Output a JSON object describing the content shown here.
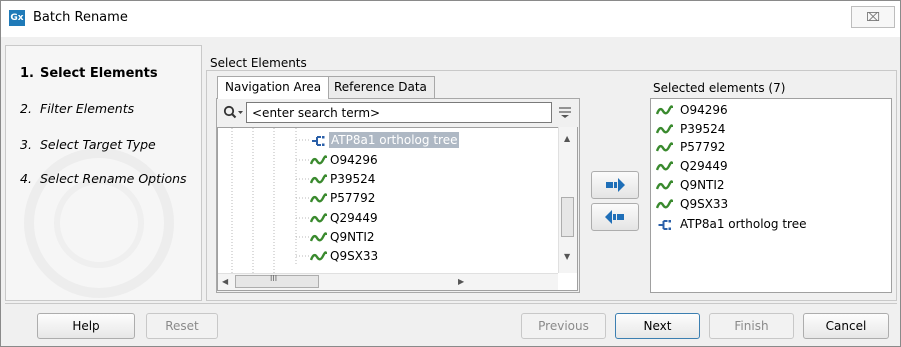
{
  "window": {
    "title": "Batch Rename",
    "app_icon_text": "Gx",
    "close_symbol": "⌧"
  },
  "steps": [
    {
      "num": "1.",
      "label": "Select Elements",
      "active": true
    },
    {
      "num": "2.",
      "label": "Filter Elements",
      "active": false
    },
    {
      "num": "3.",
      "label": "Select Target Type",
      "active": false
    },
    {
      "num": "4.",
      "label": "Select Rename Options",
      "active": false
    }
  ],
  "main": {
    "section_label": "Select Elements",
    "tabs": [
      {
        "label": "Navigation Area",
        "active": true
      },
      {
        "label": "Reference Data",
        "active": false
      }
    ],
    "search": {
      "placeholder": "<enter search term>",
      "value": ""
    },
    "tree": [
      {
        "label": "ATP8a1 ortholog tree",
        "icon": "tree-icon",
        "selected": true
      },
      {
        "label": "O94296",
        "icon": "sequence-icon",
        "selected": false
      },
      {
        "label": "P39524",
        "icon": "sequence-icon",
        "selected": false
      },
      {
        "label": "P57792",
        "icon": "sequence-icon",
        "selected": false
      },
      {
        "label": "Q29449",
        "icon": "sequence-icon",
        "selected": false
      },
      {
        "label": "Q9NTI2",
        "icon": "sequence-icon",
        "selected": false
      },
      {
        "label": "Q9SX33",
        "icon": "sequence-icon",
        "selected": false
      }
    ],
    "hscroll_glyph": "III"
  },
  "selected": {
    "label": "Selected elements (7)",
    "items": [
      {
        "label": "O94296",
        "icon": "sequence-icon"
      },
      {
        "label": "P39524",
        "icon": "sequence-icon"
      },
      {
        "label": "P57792",
        "icon": "sequence-icon"
      },
      {
        "label": "Q29449",
        "icon": "sequence-icon"
      },
      {
        "label": "Q9NTI2",
        "icon": "sequence-icon"
      },
      {
        "label": "Q9SX33",
        "icon": "sequence-icon"
      },
      {
        "label": "ATP8a1 ortholog tree",
        "icon": "tree-icon"
      }
    ]
  },
  "buttons": {
    "help": "Help",
    "reset": "Reset",
    "previous": "Previous",
    "next": "Next",
    "finish": "Finish",
    "cancel": "Cancel"
  },
  "colors": {
    "accent": "#1f7ab8",
    "sequence_icon": "#3a8a2e",
    "tree_icon": "#2a5fa8",
    "selection": "#aeb8c4"
  }
}
